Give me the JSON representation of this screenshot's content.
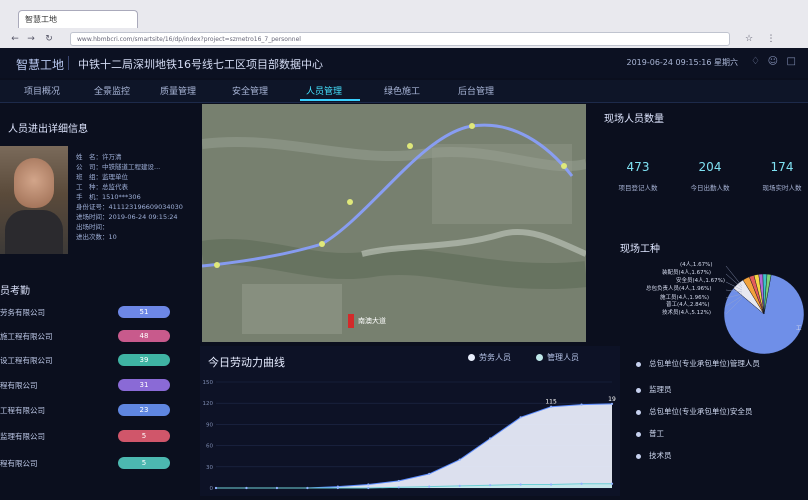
{
  "browser": {
    "tab_title": "智慧工地",
    "url": "www.hbmbcri.com/smartsite/16/dp/index?project=szmetro16_7_personnel"
  },
  "header": {
    "brand": "智慧工地",
    "title": "中铁十二局深圳地铁16号线七工区项目部数据中心",
    "datetime": "2019-06-24 09:15:16 星期六"
  },
  "tabs": [
    {
      "label": "项目概况"
    },
    {
      "label": "全景监控"
    },
    {
      "label": "质量管理"
    },
    {
      "label": "安全管理"
    },
    {
      "label": "人员管理"
    },
    {
      "label": "绿色施工"
    },
    {
      "label": "后台管理"
    }
  ],
  "person_panel": {
    "title": "人员进出详细信息",
    "rows": [
      {
        "label": "姓　名：",
        "value": "许万清"
      },
      {
        "label": "公　司：",
        "value": "中铁隧道工程建设..."
      },
      {
        "label": "班　组：",
        "value": "监理单位"
      },
      {
        "label": "工　种：",
        "value": "总监代表"
      },
      {
        "label": "手　机：",
        "value": "1510***306"
      },
      {
        "label": "身份证号：",
        "value": "411123196609034030"
      },
      {
        "label": "进场时间：",
        "value": "2019-06-24 09:15:24"
      },
      {
        "label": "出场时间：",
        "value": ""
      },
      {
        "label": "进出次数：",
        "value": "10"
      }
    ]
  },
  "attendance": {
    "title": "员考勤",
    "rows": [
      {
        "name": "劳务有限公司",
        "count": "51",
        "color": "#6d87e6"
      },
      {
        "name": "施工程有限公司",
        "count": "48",
        "color": "#c85a8c"
      },
      {
        "name": "设工程有限公司",
        "count": "39",
        "color": "#3fb3a3"
      },
      {
        "name": "程有限公司",
        "count": "31",
        "color": "#8a6ad6"
      },
      {
        "name": "工程有限公司",
        "count": "23",
        "color": "#5f86e0"
      },
      {
        "name": "监理有限公司",
        "count": "5",
        "color": "#d0566a"
      },
      {
        "name": "程有限公司",
        "count": "5",
        "color": "#4cb8b0"
      }
    ]
  },
  "map": {
    "place_label": "南澳大道"
  },
  "chart": {
    "title": "今日劳动力曲线",
    "legend": [
      "劳务人员",
      "管理人员"
    ]
  },
  "chart_data": {
    "type": "area",
    "title": "今日劳动力曲线",
    "y_ticks": [
      "150",
      "120",
      "90",
      "60",
      "30",
      "0"
    ],
    "ylim": [
      0,
      150
    ],
    "series": [
      {
        "name": "劳务人员",
        "values": [
          0,
          0,
          0,
          0,
          2,
          5,
          10,
          20,
          40,
          70,
          100,
          115,
          118,
          119
        ]
      },
      {
        "name": "管理人员",
        "values": [
          0,
          0,
          0,
          0,
          0,
          0,
          1,
          2,
          3,
          4,
          5,
          5,
          6,
          6
        ]
      }
    ],
    "data_labels": [
      {
        "text": "115",
        "series": 0,
        "index": 11
      },
      {
        "text": "19",
        "series": 0,
        "index": 13
      }
    ]
  },
  "stats": {
    "title": "现场人员数量",
    "items": [
      {
        "value": "473",
        "label": "项目登记人数"
      },
      {
        "value": "204",
        "label": "今日出勤人数"
      },
      {
        "value": "174",
        "label": "现场实时人数"
      }
    ]
  },
  "jobs": {
    "title": "现场工种",
    "pie_labels": [
      {
        "text": "(4人,1.67%)"
      },
      {
        "text": "装配员(4人,1.67%)"
      },
      {
        "text": "安全员(4人,1.67%)"
      },
      {
        "text": "总包负责人员(4人,1.96%)"
      },
      {
        "text": "施工员(4人,1.96%)"
      },
      {
        "text": "普工(4人,2.84%)"
      },
      {
        "text": "技术员(4人,5.12%)"
      },
      {
        "text": "工"
      }
    ],
    "slices": [
      {
        "value": 84.0,
        "color": "#6f8fe8"
      },
      {
        "value": 5.12,
        "color": "#e8e8f0"
      },
      {
        "value": 2.84,
        "color": "#f2a23c"
      },
      {
        "value": 1.96,
        "color": "#e25b5b"
      },
      {
        "value": 1.96,
        "color": "#f6d545"
      },
      {
        "value": 1.67,
        "color": "#b06ad6"
      },
      {
        "value": 1.67,
        "color": "#3fc1c9"
      },
      {
        "value": 1.67,
        "color": "#7ad27a"
      }
    ],
    "list": [
      {
        "label": "总包单位(专业承包单位)管理人员"
      },
      {
        "label": "监理员"
      },
      {
        "label": "总包单位(专业承包单位)安全员"
      },
      {
        "label": "普工"
      },
      {
        "label": "技术员"
      }
    ]
  }
}
